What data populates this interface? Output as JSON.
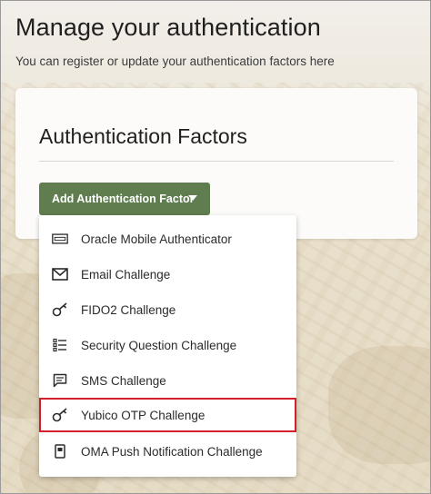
{
  "page": {
    "title": "Manage your authentication",
    "subtitle": "You can register or update your authentication factors here"
  },
  "card": {
    "title": "Authentication Factors",
    "add_button_label": "Add Authentication Factor"
  },
  "menu": {
    "items": [
      {
        "label": "Oracle Mobile Authenticator",
        "icon": "mobile-authenticator-icon"
      },
      {
        "label": "Email Challenge",
        "icon": "envelope-icon"
      },
      {
        "label": "FIDO2 Challenge",
        "icon": "key-icon"
      },
      {
        "label": "Security Question Challenge",
        "icon": "list-icon"
      },
      {
        "label": "SMS Challenge",
        "icon": "chat-bubble-icon"
      },
      {
        "label": "Yubico OTP Challenge",
        "icon": "key-icon"
      },
      {
        "label": "OMA Push Notification Challenge",
        "icon": "phone-notification-icon"
      }
    ],
    "highlighted_item": "Yubico OTP Challenge"
  },
  "colors": {
    "button": "#5f7d4f",
    "highlight_border": "#d21f2b"
  }
}
